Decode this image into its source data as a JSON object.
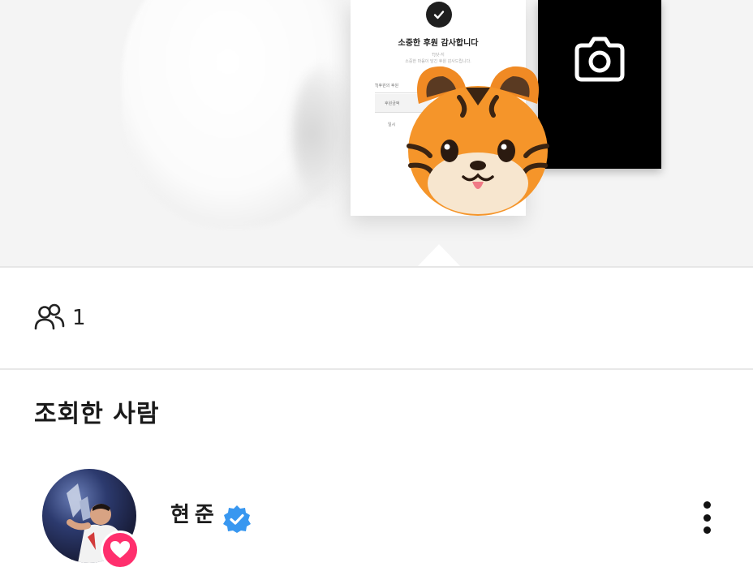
{
  "preview": {
    "card_title": "소중한 후원 감사합니다",
    "card_line1": "TJ닷-지",
    "card_line2": "소중한 마음이 담긴 후원 감사드립니다.",
    "card_table_label": "TJ후원의 후원",
    "card_cell_a": "후원금액",
    "card_cell_b": "일시"
  },
  "viewers": {
    "count": "1"
  },
  "section": {
    "title": "조회한 사람"
  },
  "viewer_list": [
    {
      "name": "현준",
      "verified": true,
      "reaction": "heart"
    }
  ],
  "colors": {
    "reaction_heart": "#ff2f6d",
    "verified_badge": "#3897f0"
  },
  "icons": [
    "checkmark-icon",
    "camera-icon",
    "tiger-sticker",
    "people-icon",
    "verified-icon",
    "heart-icon",
    "more-options-icon"
  ]
}
